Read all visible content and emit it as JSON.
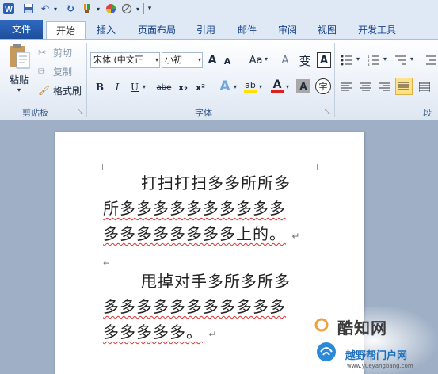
{
  "quick_access": {
    "undo_glyph": "↶",
    "redo_glyph": "↻",
    "customize_glyph": "▾"
  },
  "tabs": [
    {
      "label": "文件"
    },
    {
      "label": "开始"
    },
    {
      "label": "插入"
    },
    {
      "label": "页面布局"
    },
    {
      "label": "引用"
    },
    {
      "label": "邮件"
    },
    {
      "label": "审阅"
    },
    {
      "label": "视图"
    },
    {
      "label": "开发工具"
    }
  ],
  "clipboard": {
    "paste_label": "粘贴",
    "cut_label": "剪切",
    "copy_label": "复制",
    "format_painter_label": "格式刷",
    "group_label": "剪贴板"
  },
  "font": {
    "font_name": "宋体 (中文正",
    "font_size": "小初",
    "group_label": "字体",
    "grow_label": "A",
    "shrink_label": "A",
    "case_label": "Aa",
    "clear_label": "A",
    "bold_label": "B",
    "italic_label": "I",
    "underline_label": "U",
    "strike_label": "abe",
    "subscript_label": "x₂",
    "superscript_label": "x²",
    "text_effect_label": "A",
    "highlight_label": "ab",
    "font_color_label": "A",
    "char_shading_label": "A",
    "enclose_label": "字",
    "phonetic_label": "变"
  },
  "paragraph": {
    "group_label": "段落"
  },
  "document": {
    "para1_line1": "打扫打扫多多所所多",
    "para1_line2": "所多多多多多多多多多多",
    "para1_line3": "多多多多多多多多上的。",
    "para2_line1": "甩掉对手多所多所多",
    "para2_line2": "多多多多多多多多多多多",
    "para2_line3": "多多多多多。",
    "para_mark": "↵"
  },
  "watermark": {
    "text1": "酷知网",
    "text2": "越野帮门户网",
    "url": "www.yueyangbang.com"
  },
  "colors": {
    "accent": "#2f6ac0",
    "squiggle": "#e03030",
    "highlight": "#ffe000",
    "font_color": "#e02020"
  }
}
